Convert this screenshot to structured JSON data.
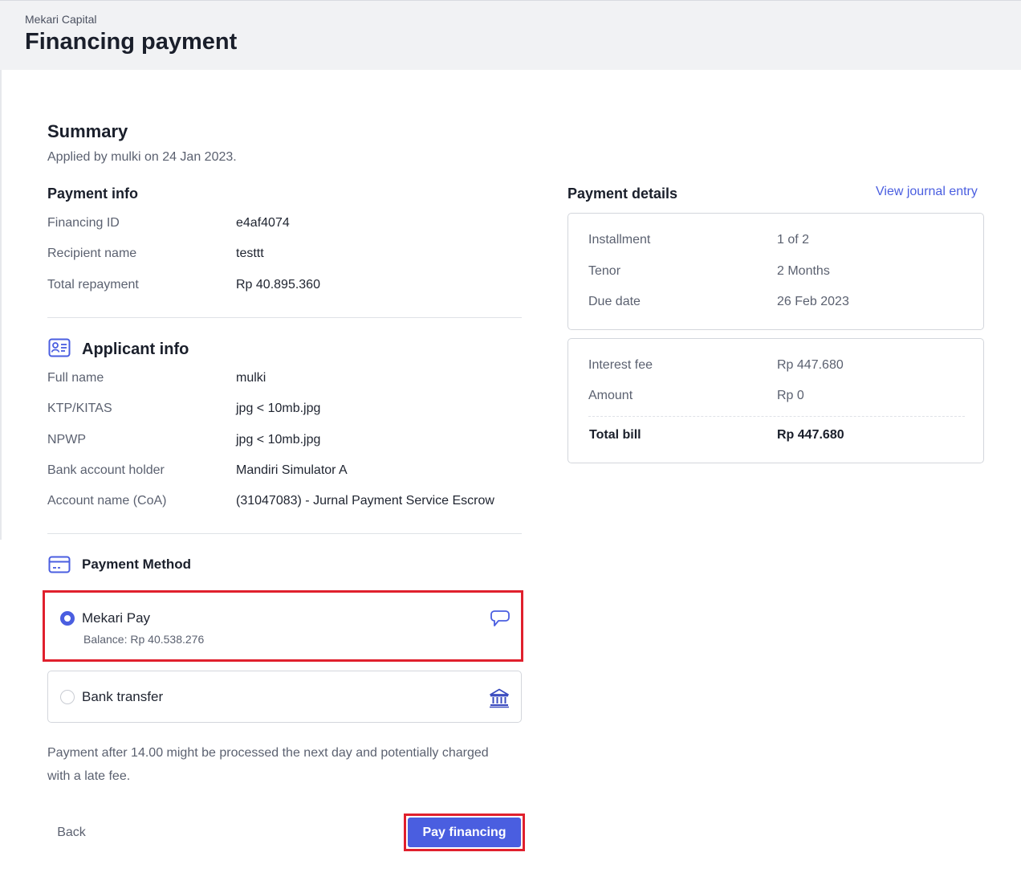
{
  "header": {
    "breadcrumb": "Mekari Capital",
    "title": "Financing payment"
  },
  "summary": {
    "title": "Summary",
    "applied_text": "Applied by mulki on 24 Jan 2023."
  },
  "payment_info": {
    "title": "Payment info",
    "rows": [
      {
        "label": "Financing ID",
        "value": "e4af4074"
      },
      {
        "label": "Recipient name",
        "value": "testtt"
      },
      {
        "label": "Total repayment",
        "value": "Rp 40.895.360"
      }
    ]
  },
  "applicant_info": {
    "title": "Applicant info",
    "icon": "id-card-icon",
    "rows": [
      {
        "label": "Full name",
        "value": "mulki"
      },
      {
        "label": "KTP/KITAS",
        "value": "jpg < 10mb.jpg"
      },
      {
        "label": "NPWP",
        "value": "jpg < 10mb.jpg"
      },
      {
        "label": "Bank account holder",
        "value": "Mandiri Simulator A"
      },
      {
        "label": "Account name (CoA)",
        "value": "(31047083) - Jurnal Payment Service Escrow"
      }
    ]
  },
  "payment_method": {
    "title": "Payment Method",
    "icon": "credit-card-icon",
    "options": [
      {
        "label": "Mekari Pay",
        "balance": "Balance: Rp 40.538.276",
        "selected": true,
        "icon": "mekari-pay-icon"
      },
      {
        "label": "Bank transfer",
        "selected": false,
        "icon": "bank-icon"
      }
    ]
  },
  "note": "Payment after 14.00 might be processed the next day and potentially charged with a late fee.",
  "actions": {
    "back": "Back",
    "pay": "Pay financing"
  },
  "payment_details": {
    "title": "Payment details",
    "journal_link": "View journal entry",
    "schedule": [
      {
        "label": "Installment",
        "value": "1 of 2"
      },
      {
        "label": "Tenor",
        "value": "2 Months"
      },
      {
        "label": "Due date",
        "value": "26 Feb 2023"
      }
    ],
    "fees": [
      {
        "label": "Interest fee",
        "value": "Rp 447.680"
      },
      {
        "label": "Amount",
        "value": "Rp 0"
      }
    ],
    "total": {
      "label": "Total bill",
      "value": "Rp 447.680"
    }
  },
  "colors": {
    "accent": "#4a5ee0",
    "highlight": "#e0202d",
    "header_bg": "#f1f2f4"
  }
}
